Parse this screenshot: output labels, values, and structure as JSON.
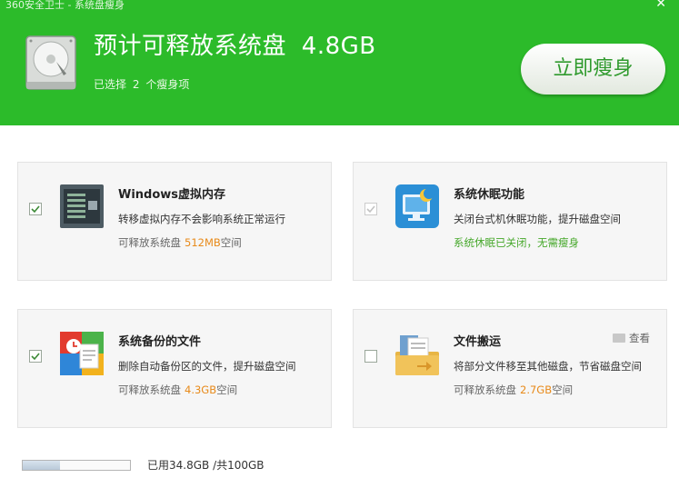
{
  "window": {
    "title": "360安全卫士 - 系统盘瘦身",
    "close_glyph": "✕"
  },
  "header": {
    "headline_prefix": "预计可释放系统盘",
    "headline_size": "4.8GB",
    "selected_prefix": "已选择",
    "selected_count": "2",
    "selected_suffix": "个瘦身项",
    "action_label": "立即瘦身"
  },
  "items": [
    {
      "title": "Windows虚拟内存",
      "desc": "转移虚拟内存不会影响系统正常运行",
      "note_prefix": "可释放系统盘",
      "note_size": "512MB",
      "note_suffix": "空间",
      "checked": true,
      "icon": "memory-chip-icon"
    },
    {
      "title": "系统休眠功能",
      "desc": "关闭台式机休眠功能，提升磁盘空间",
      "status": "系统休眠已关闭，无需瘦身",
      "checked": true,
      "disabled": true,
      "icon": "hibernate-monitor-icon"
    },
    {
      "title": "系统备份的文件",
      "desc": "删除自动备份区的文件，提升磁盘空间",
      "note_prefix": "可释放系统盘",
      "note_size": "4.3GB",
      "note_suffix": "空间",
      "checked": true,
      "icon": "backup-files-icon"
    },
    {
      "title": "文件搬运",
      "desc": "将部分文件移至其他磁盘，节省磁盘空间",
      "note_prefix": "可释放系统盘",
      "note_size": "2.7GB",
      "note_suffix": "空间",
      "checked": false,
      "view_label": "查看",
      "icon": "file-move-icon"
    }
  ],
  "footer": {
    "usage_text": "已用34.8GB /共100GB",
    "used_fraction": 0.348
  },
  "colors": {
    "header_green": "#2cbb2a",
    "size_orange": "#e88a1a",
    "status_green": "#46a82b"
  }
}
